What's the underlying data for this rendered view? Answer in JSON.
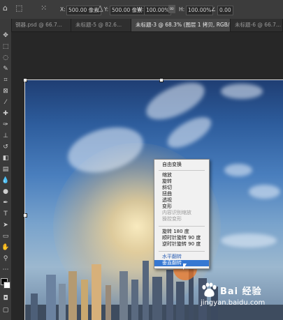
{
  "options_bar": {
    "x_label": "X:",
    "x_value": "500.00 像素",
    "y_label": "Y:",
    "y_value": "500.00 像素",
    "w_label": "W:",
    "w_value": "100.00%",
    "h_label": "H:",
    "h_value": "100.00%",
    "angle_label": "∠",
    "angle_value": "0.00"
  },
  "tabs": [
    {
      "label": "钢器.psd @ 66.7..."
    },
    {
      "label": "未标题-5 @ 82.6..."
    },
    {
      "label": "未标题-3 @ 68.3% (图层 1 拷贝, RGB/8#) *"
    },
    {
      "label": "未标题-6 @ 66.7..."
    }
  ],
  "context_menu": {
    "items": [
      {
        "label": "自由变换",
        "state": "normal"
      },
      {
        "label": "缩放",
        "state": "normal"
      },
      {
        "label": "旋转",
        "state": "normal"
      },
      {
        "label": "斜切",
        "state": "normal"
      },
      {
        "label": "扭曲",
        "state": "normal"
      },
      {
        "label": "透视",
        "state": "normal"
      },
      {
        "label": "变形",
        "state": "normal"
      },
      {
        "label": "内容识别缩放",
        "state": "disabled"
      },
      {
        "label": "操控变形",
        "state": "disabled"
      },
      {
        "label": "旋转 180 度",
        "state": "normal"
      },
      {
        "label": "顺时针旋转 90 度",
        "state": "normal"
      },
      {
        "label": "逆时针旋转 90 度",
        "state": "normal"
      },
      {
        "label": "水平翻转",
        "state": "normal"
      },
      {
        "label": "垂直翻转",
        "state": "highlighted"
      }
    ]
  },
  "watermark": {
    "brand": "Bai 经验",
    "url": "jingyan.baidu.com"
  },
  "colors": {
    "menu_highlight": "#3678d2",
    "cursor_highlight": "#ee7828"
  }
}
